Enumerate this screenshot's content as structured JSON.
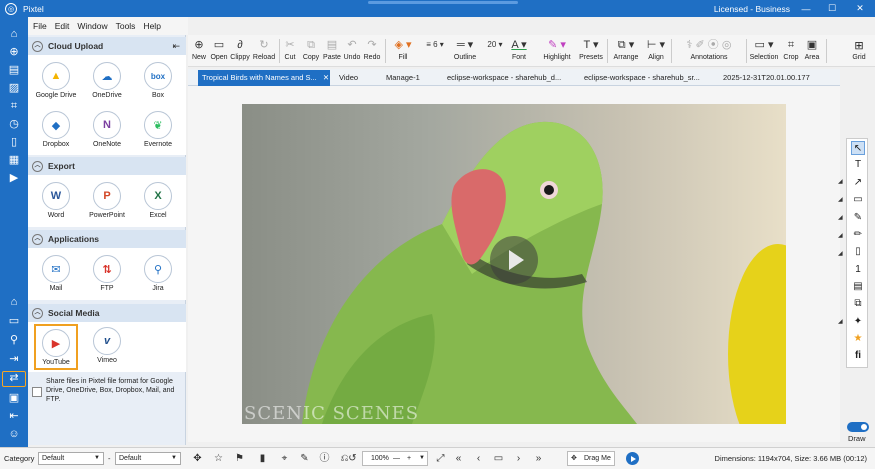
{
  "window": {
    "title": "Pixtel",
    "license": "Licensed - Business",
    "logo_glyph": "◎",
    "minimize": "—",
    "maximize": "☐",
    "close": "✕"
  },
  "menu": [
    "File",
    "Edit",
    "Window",
    "Tools",
    "Help"
  ],
  "rail_icons": [
    "home-icon",
    "add-circle-icon",
    "document-icon",
    "image-icon",
    "crop-frame-icon",
    "timer-icon",
    "bookmark-icon",
    "layout-icon",
    "video-icon",
    "house-icon",
    "folder-icon",
    "search-icon",
    "export-icon",
    "share-icon",
    "badge-icon",
    "exit-icon",
    "user-icon"
  ],
  "panel": {
    "pin_glyph": "⇤",
    "sections": [
      {
        "title": "Cloud Upload",
        "items": [
          {
            "label": "Google Drive",
            "glyph": "▲",
            "color": "#f4b400",
            "icon": "google-drive-icon"
          },
          {
            "label": "OneDrive",
            "glyph": "☁",
            "color": "#1f6fc4",
            "icon": "onedrive-icon"
          },
          {
            "label": "Box",
            "glyph": "box",
            "color": "#1f6fc4",
            "icon": "box-icon"
          },
          {
            "label": "Dropbox",
            "glyph": "◆",
            "color": "#1f6fc4",
            "icon": "dropbox-icon"
          },
          {
            "label": "OneNote",
            "glyph": "N",
            "color": "#7b3fa0",
            "icon": "onenote-icon"
          },
          {
            "label": "Evernote",
            "glyph": "❦",
            "color": "#2dbe60",
            "icon": "evernote-icon"
          }
        ]
      },
      {
        "title": "Export",
        "items": [
          {
            "label": "Word",
            "glyph": "W",
            "color": "#2b579a",
            "icon": "word-icon"
          },
          {
            "label": "PowerPoint",
            "glyph": "P",
            "color": "#d24726",
            "icon": "powerpoint-icon"
          },
          {
            "label": "Excel",
            "glyph": "X",
            "color": "#217346",
            "icon": "excel-icon"
          }
        ]
      },
      {
        "title": "Applications",
        "items": [
          {
            "label": "Mail",
            "glyph": "✉",
            "color": "#1f6fc4",
            "icon": "mail-icon"
          },
          {
            "label": "FTP",
            "glyph": "⇅",
            "color": "#d9342b",
            "icon": "ftp-icon"
          },
          {
            "label": "Jira",
            "glyph": "⚲",
            "color": "#1f6fc4",
            "icon": "jira-icon"
          }
        ]
      },
      {
        "title": "Social Media",
        "items": [
          {
            "label": "YouTube",
            "glyph": "▶",
            "color": "#d9342b",
            "icon": "youtube-icon"
          },
          {
            "label": "Vimeo",
            "glyph": "v",
            "color": "#1f4e8c",
            "icon": "vimeo-icon"
          }
        ]
      }
    ],
    "share_text": "Share files in Pixtel file format for Google Drive, OneDrive, Box, Dropbox, Mail, and FTP."
  },
  "toolbar": [
    {
      "label": "New",
      "glyph": "⊕",
      "icon": "new-icon"
    },
    {
      "label": "Open",
      "glyph": "📂",
      "icon": "open-icon"
    },
    {
      "label": "Clippy",
      "glyph": "📎",
      "icon": "clippy-icon"
    },
    {
      "label": "Reload",
      "glyph": "↻",
      "icon": "reload-icon"
    },
    {
      "label": "Cut",
      "glyph": "✂",
      "icon": "cut-icon"
    },
    {
      "label": "Copy",
      "glyph": "⧉",
      "icon": "copy-icon"
    },
    {
      "label": "Paste",
      "glyph": "📋",
      "icon": "paste-icon"
    },
    {
      "label": "Undo",
      "glyph": "↶",
      "icon": "undo-icon"
    },
    {
      "label": "Redo",
      "glyph": "↷",
      "icon": "redo-icon"
    },
    {
      "label": "Fill",
      "glyph": "◈",
      "icon": "fill-icon"
    },
    {
      "label": "Outline",
      "glyph": "═",
      "icon": "outline-icon"
    },
    {
      "label": "Font",
      "glyph": "A",
      "icon": "font-icon"
    },
    {
      "label": "Highlight",
      "glyph": "✎",
      "icon": "highlight-icon"
    },
    {
      "label": "Presets",
      "glyph": "T",
      "icon": "presets-icon"
    },
    {
      "label": "Arrange",
      "glyph": "⧉",
      "icon": "arrange-icon"
    },
    {
      "label": "Align",
      "glyph": "⊢",
      "icon": "align-icon"
    },
    {
      "label": "Annotations",
      "glyph": "✐",
      "icon": "annotations-icon"
    },
    {
      "label": "Selection",
      "glyph": "▭",
      "icon": "selection-icon"
    },
    {
      "label": "Crop",
      "glyph": "⌗",
      "icon": "crop-icon"
    },
    {
      "label": "Area",
      "glyph": "▣",
      "icon": "area-icon"
    }
  ],
  "toolbar_fields": {
    "line_count": "6",
    "font_size": "20"
  },
  "grid": {
    "label": "Grid",
    "glyph": "⊞"
  },
  "tabs": [
    {
      "label": "Tropical Birds with Names and S...",
      "active": true,
      "close": "✕"
    },
    {
      "label": "Video"
    },
    {
      "label": "Manage-1"
    },
    {
      "label": "eclipse-workspace - sharehub_d..."
    },
    {
      "label": "eclipse-workspace - sharehub_sr..."
    },
    {
      "label": "2025-12-31T20.01.00.177"
    }
  ],
  "video": {
    "watermark": "SCENIC SCENES"
  },
  "right_tools": [
    "↖",
    "T",
    "↗",
    "▭",
    "✎",
    "✏",
    "▯",
    "1",
    "▤",
    "⧉",
    "✦",
    "★",
    "fi"
  ],
  "right_tool_names": [
    "pointer-icon",
    "text-icon",
    "arrow-icon",
    "rectangle-icon",
    "pen-icon",
    "marker-icon",
    "page-icon",
    "step-number-icon",
    "stamp-icon",
    "copy-stack-icon",
    "magic-icon",
    "star-icon",
    "fi-icon"
  ],
  "draw": {
    "label": "Draw",
    "enabled": true
  },
  "status": {
    "category_label": "Category",
    "category_value": "Default",
    "second_value": "Default",
    "separator": "-",
    "zoom": "100%",
    "zoom_minus": "—",
    "zoom_plus": "+",
    "drag_label": "Drag Me",
    "dimensions": "Dimensions: 1194x704, Size: 3.66 MB (00:12)",
    "icons": [
      "☆",
      "⚑",
      "▮",
      "⌖",
      "✎",
      "ⓘ",
      "⎌",
      "↺",
      "«",
      "‹",
      "▭",
      "›",
      "»",
      "✥"
    ]
  }
}
